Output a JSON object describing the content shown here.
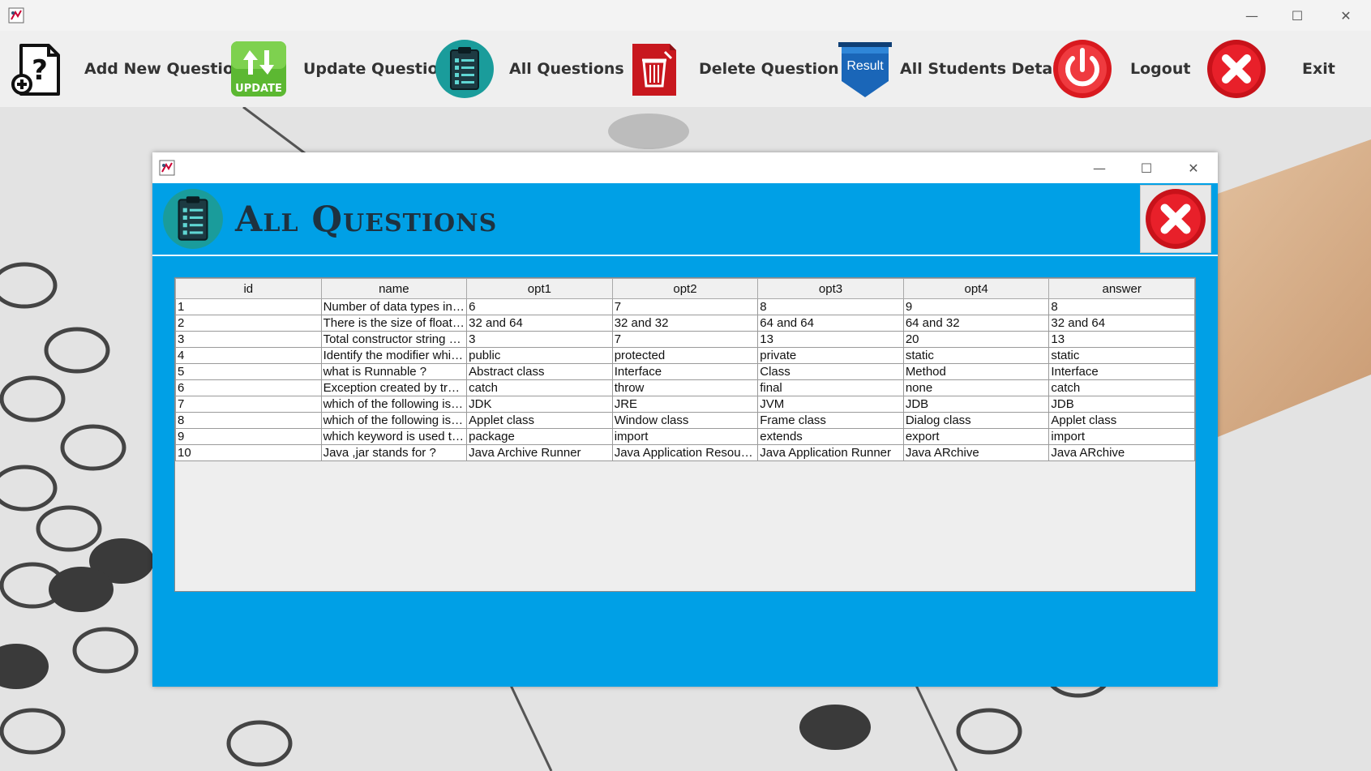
{
  "toolbar": {
    "items": [
      {
        "label": "Add New Question",
        "icon": "add-question-icon"
      },
      {
        "label": "Update Question",
        "icon": "update-icon",
        "icon_text": "UPDATE"
      },
      {
        "label": "All Questions",
        "icon": "clipboard-list-icon"
      },
      {
        "label": "Delete Question",
        "icon": "trash-icon"
      },
      {
        "label": "All Students Details",
        "icon": "result-ribbon-icon",
        "icon_text": "Result"
      },
      {
        "label": "Logout",
        "icon": "power-icon"
      },
      {
        "label": "Exit",
        "icon": "close-circle-icon"
      }
    ]
  },
  "window_controls": {
    "minimize": "—",
    "maximize": "☐",
    "close": "✕"
  },
  "frame": {
    "title": "All Questions",
    "controls": {
      "minimize": "—",
      "maximize": "☐",
      "close": "✕"
    }
  },
  "table": {
    "columns": [
      "id",
      "name",
      "opt1",
      "opt2",
      "opt3",
      "opt4",
      "answer"
    ],
    "rows": [
      [
        "1",
        "Number of data types in J...",
        "6",
        "7",
        "8",
        "9",
        "8"
      ],
      [
        "2",
        "There is the size of float an...",
        "32 and 64",
        "32 and 32",
        "64 and 64",
        "64 and 32",
        "32 and 64"
      ],
      [
        "3",
        "Total constructor string cla...",
        "3",
        "7",
        "13",
        "20",
        "13"
      ],
      [
        "4",
        "Identify the modifier which ...",
        "public",
        "protected",
        "private",
        "static",
        "static"
      ],
      [
        "5",
        "what is Runnable ?",
        "Abstract class",
        "Interface",
        "Class",
        "Method",
        "Interface"
      ],
      [
        "6",
        "Exception created by try bl...",
        "catch",
        "throw",
        "final",
        "none",
        "catch"
      ],
      [
        "7",
        "which of the following is ue...",
        "JDK",
        "JRE",
        "JVM",
        "JDB",
        "JDB"
      ],
      [
        "8",
        "which of the following is an...",
        "Applet class",
        "Window class",
        "Frame class",
        "Dialog class",
        "Applet class"
      ],
      [
        "9",
        "which keyword is used to ...",
        "package",
        "import",
        "extends",
        "export",
        "import"
      ],
      [
        "10",
        "Java ,jar stands for ?",
        "Java Archive Runner",
        "Java Application Resource",
        "Java Application Runner",
        "Java ARchive",
        "Java ARchive"
      ]
    ]
  },
  "colors": {
    "frame_bg": "#00a0e6",
    "title_text": "#1e3240",
    "toolbar_bg": "#efefef",
    "close_red": "#e8202a"
  }
}
